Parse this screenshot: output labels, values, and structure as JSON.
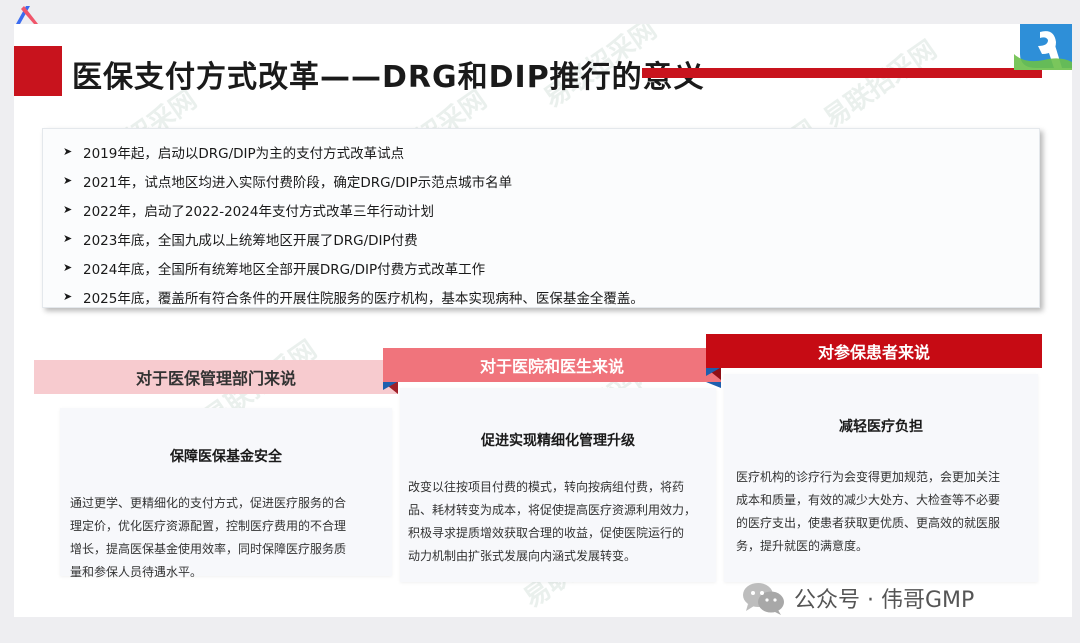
{
  "slide": {
    "title": "医保支付方式改革——DRG和DIP推行的意义",
    "watermark_text": "易联招采网"
  },
  "timeline": [
    "2019年起，启动以DRG/DIP为主的支付方式改革试点",
    "2021年，试点地区均进入实际付费阶段，确定DRG/DIP示范点城市名单",
    "2022年，启动了2022-2024年支付方式改革三年行动计划",
    "2023年底，全国九成以上统筹地区开展了DRG/DIP付费",
    "2024年底，全国所有统筹地区全部开展DRG/DIP付费方式改革工作",
    "2025年底，覆盖所有符合条件的开展住院服务的医疗机构，基本实现病种、医保基金全覆盖。"
  ],
  "columns": [
    {
      "header": "对于医保管理部门来说",
      "title": "保障医保基金安全",
      "lines": [
        "通过更学、更精细化的支付方式，促进医疗服务的合",
        "理定价，优化医疗资源配置，控制医疗费用的不合理",
        "增长，提高医保基金使用效率，同时保障医疗服务质",
        "量和参保人员待遇水平。"
      ]
    },
    {
      "header": "对于医院和医生来说",
      "title": "促进实现精细化管理升级",
      "lines": [
        "改变以往按项目付费的模式，转向按病组付费，将药",
        "品、耗材转变为成本，将促使提高医疗资源利用效力，",
        "积极寻求提质增效获取合理的收益，促使医院运行的",
        "动力机制由扩张式发展向内涵式发展转变。"
      ]
    },
    {
      "header": "对参保患者来说",
      "title": "减轻医疗负担",
      "lines": [
        "医疗机构的诊疗行为会变得更加规范，会更加关注",
        "成本和质量，有效的减少大处方、大检查等不必要",
        "的医疗支出，使患者获取更优质、更高效的就医服",
        "务，提升就医的满意度。"
      ]
    }
  ],
  "footer": {
    "label": "公众号 · 伟哥GMP"
  },
  "colors": {
    "brand_red": "#c8131d",
    "header_pink": "#f7cbcf",
    "header_coral": "#f0747c",
    "header_red": "#c60b14"
  },
  "icons": [
    "app-logo-icon",
    "corner-logo-icon",
    "wechat-icon",
    "arrow-bullet-icon"
  ]
}
